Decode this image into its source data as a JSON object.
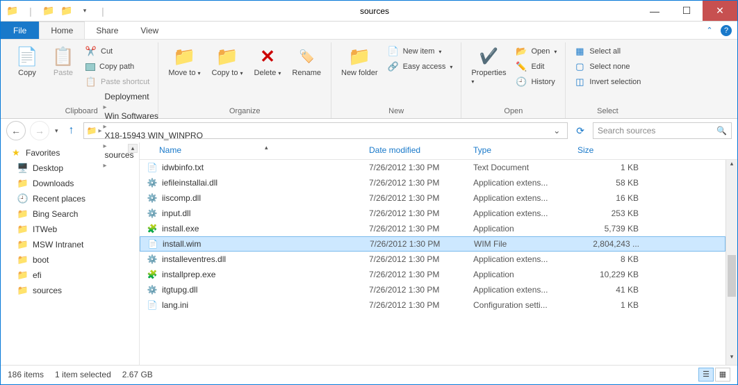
{
  "window": {
    "title": "sources"
  },
  "tabs": {
    "file": "File",
    "home": "Home",
    "share": "Share",
    "view": "View"
  },
  "ribbon": {
    "clipboard": {
      "label": "Clipboard",
      "copy": "Copy",
      "paste": "Paste",
      "cut": "Cut",
      "copy_path": "Copy path",
      "paste_shortcut": "Paste shortcut"
    },
    "organize": {
      "label": "Organize",
      "move_to": "Move to",
      "copy_to": "Copy to",
      "delete": "Delete",
      "rename": "Rename"
    },
    "new": {
      "label": "New",
      "new_folder": "New folder",
      "new_item": "New item",
      "easy_access": "Easy access"
    },
    "open": {
      "label": "Open",
      "properties": "Properties",
      "open": "Open",
      "edit": "Edit",
      "history": "History"
    },
    "select": {
      "label": "Select",
      "select_all": "Select all",
      "select_none": "Select none",
      "invert": "Invert selection"
    }
  },
  "breadcrumbs": [
    "Deployment",
    "Win Softwares",
    "X18-15943 WIN_WINPRO",
    "sources"
  ],
  "search": {
    "placeholder": "Search sources"
  },
  "sidebar": {
    "favorites": "Favorites",
    "items": [
      {
        "label": "Desktop",
        "icon": "desktop"
      },
      {
        "label": "Downloads",
        "icon": "folder"
      },
      {
        "label": "Recent places",
        "icon": "recent"
      },
      {
        "label": "Bing Search",
        "icon": "folder"
      },
      {
        "label": "ITWeb",
        "icon": "folder"
      },
      {
        "label": "MSW Intranet",
        "icon": "folder"
      },
      {
        "label": "boot",
        "icon": "folder"
      },
      {
        "label": "efi",
        "icon": "folder"
      },
      {
        "label": "sources",
        "icon": "folder"
      }
    ]
  },
  "columns": {
    "name": "Name",
    "date": "Date modified",
    "type": "Type",
    "size": "Size"
  },
  "files": [
    {
      "name": "idwbinfo.txt",
      "date": "7/26/2012 1:30 PM",
      "type": "Text Document",
      "size": "1 KB",
      "icon": "txt"
    },
    {
      "name": "iefileinstallai.dll",
      "date": "7/26/2012 1:30 PM",
      "type": "Application extens...",
      "size": "58 KB",
      "icon": "dll"
    },
    {
      "name": "iiscomp.dll",
      "date": "7/26/2012 1:30 PM",
      "type": "Application extens...",
      "size": "16 KB",
      "icon": "dll"
    },
    {
      "name": "input.dll",
      "date": "7/26/2012 1:30 PM",
      "type": "Application extens...",
      "size": "253 KB",
      "icon": "dll"
    },
    {
      "name": "install.exe",
      "date": "7/26/2012 1:30 PM",
      "type": "Application",
      "size": "5,739 KB",
      "icon": "exe"
    },
    {
      "name": "install.wim",
      "date": "7/26/2012 1:30 PM",
      "type": "WIM File",
      "size": "2,804,243 ...",
      "icon": "file",
      "selected": true
    },
    {
      "name": "installeventres.dll",
      "date": "7/26/2012 1:30 PM",
      "type": "Application extens...",
      "size": "8 KB",
      "icon": "dll"
    },
    {
      "name": "installprep.exe",
      "date": "7/26/2012 1:30 PM",
      "type": "Application",
      "size": "10,229 KB",
      "icon": "exe"
    },
    {
      "name": "itgtupg.dll",
      "date": "7/26/2012 1:30 PM",
      "type": "Application extens...",
      "size": "41 KB",
      "icon": "dll"
    },
    {
      "name": "lang.ini",
      "date": "7/26/2012 1:30 PM",
      "type": "Configuration setti...",
      "size": "1 KB",
      "icon": "ini"
    }
  ],
  "status": {
    "count": "186 items",
    "selection": "1 item selected",
    "size": "2.67 GB"
  }
}
